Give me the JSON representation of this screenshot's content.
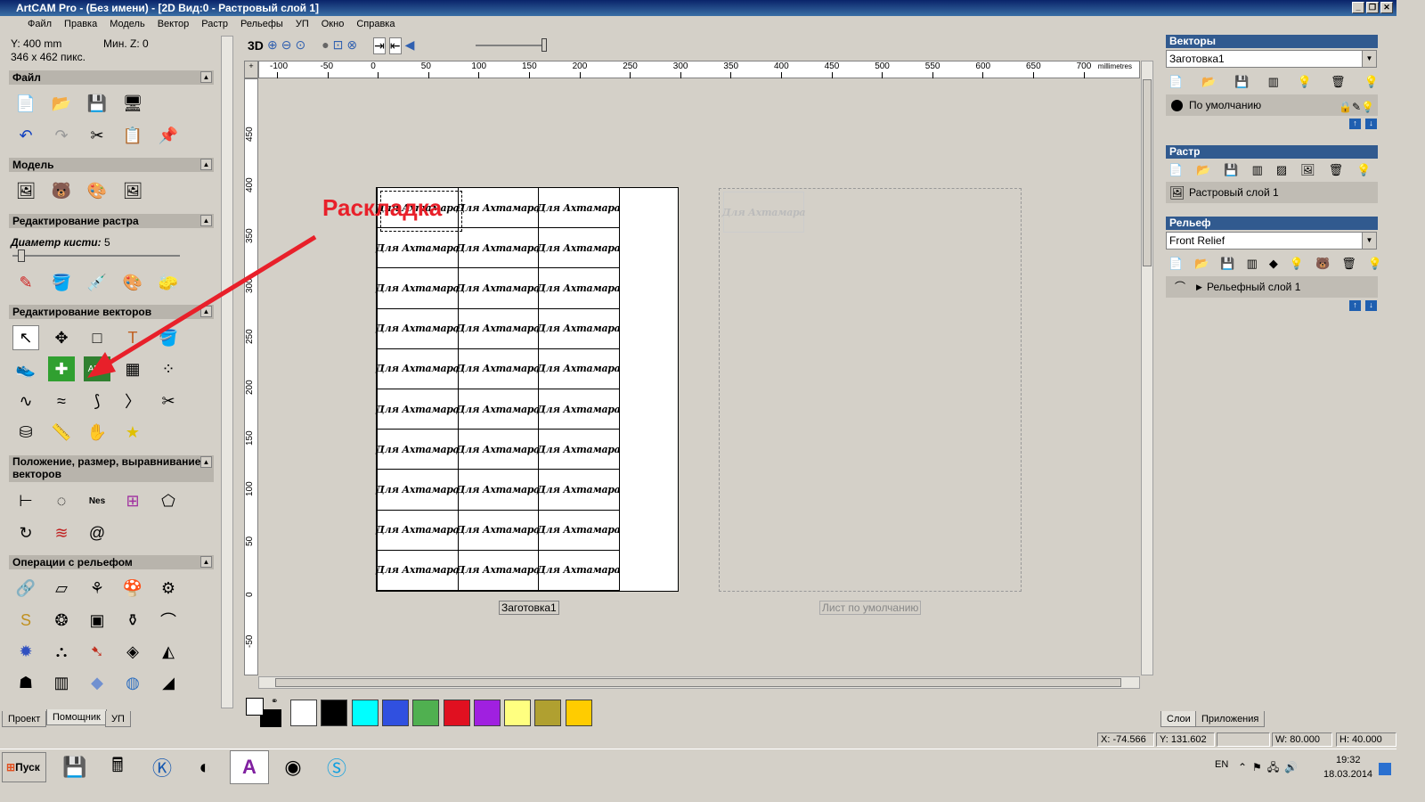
{
  "window": {
    "title": "ArtCAM Pro - (Без имени) - [2D Вид:0 - Растровый слой 1]"
  },
  "menu": [
    "Файл",
    "Правка",
    "Модель",
    "Вектор",
    "Растр",
    "Рельефы",
    "УП",
    "Окно",
    "Справка"
  ],
  "info": {
    "y": "Y: 400 mm",
    "minz": "Мин. Z: 0",
    "pixels": "346 x 462 пикс."
  },
  "sections": {
    "file": "Файл",
    "model": "Модель",
    "raster_edit": "Редактирование растра",
    "brush_label": "Диаметр кисти:",
    "brush_value": "5",
    "vector_edit": "Редактирование векторов",
    "position": "Положение, размер, выравнивание векторов",
    "relief_ops": "Операции с рельефом"
  },
  "left_tabs": [
    "Проект",
    "Помощник",
    "УП"
  ],
  "view_toolbar": {
    "mode3d": "3D"
  },
  "ruler": {
    "units": "millimetres",
    "h_ticks": [
      "-100",
      "-50",
      "0",
      "50",
      "100",
      "150",
      "200",
      "250",
      "300",
      "350",
      "400",
      "450",
      "500",
      "550",
      "600",
      "650",
      "700"
    ],
    "v_ticks": [
      "450",
      "400",
      "350",
      "300",
      "250",
      "200",
      "150",
      "100",
      "50",
      "0",
      "-50"
    ]
  },
  "canvas": {
    "annotation": "Раскладка",
    "annotation_color": "#e8202a",
    "cell_text": "Для Ахтамара",
    "rows": 10,
    "cols": 3,
    "sheet1_label": "Заготовка1",
    "sheet2_label": "Лист по умолчанию"
  },
  "palette": [
    "#ffffff",
    "#000000",
    "#00ffff",
    "#3050e0",
    "#50b050",
    "#e01020",
    "#a020e0",
    "#ffff80",
    "#b0a030",
    "#ffcc00"
  ],
  "right": {
    "vectors_title": "Векторы",
    "vectors_combo": "Заготовка1",
    "vector_layer": "По умолчанию",
    "raster_title": "Растр",
    "raster_layer": "Растровый слой 1",
    "relief_title": "Рельеф",
    "relief_combo": "Front Relief",
    "relief_layer": "Рельефный слой 1",
    "tabs": [
      "Слои",
      "Приложения"
    ]
  },
  "status": {
    "x": "X: -74.566",
    "y": "Y: 131.602",
    "w": "W: 80.000",
    "h": "H: 40.000"
  },
  "taskbar": {
    "start": "Пуск",
    "lang": "EN",
    "time": "19:32",
    "date": "18.03.2014"
  }
}
